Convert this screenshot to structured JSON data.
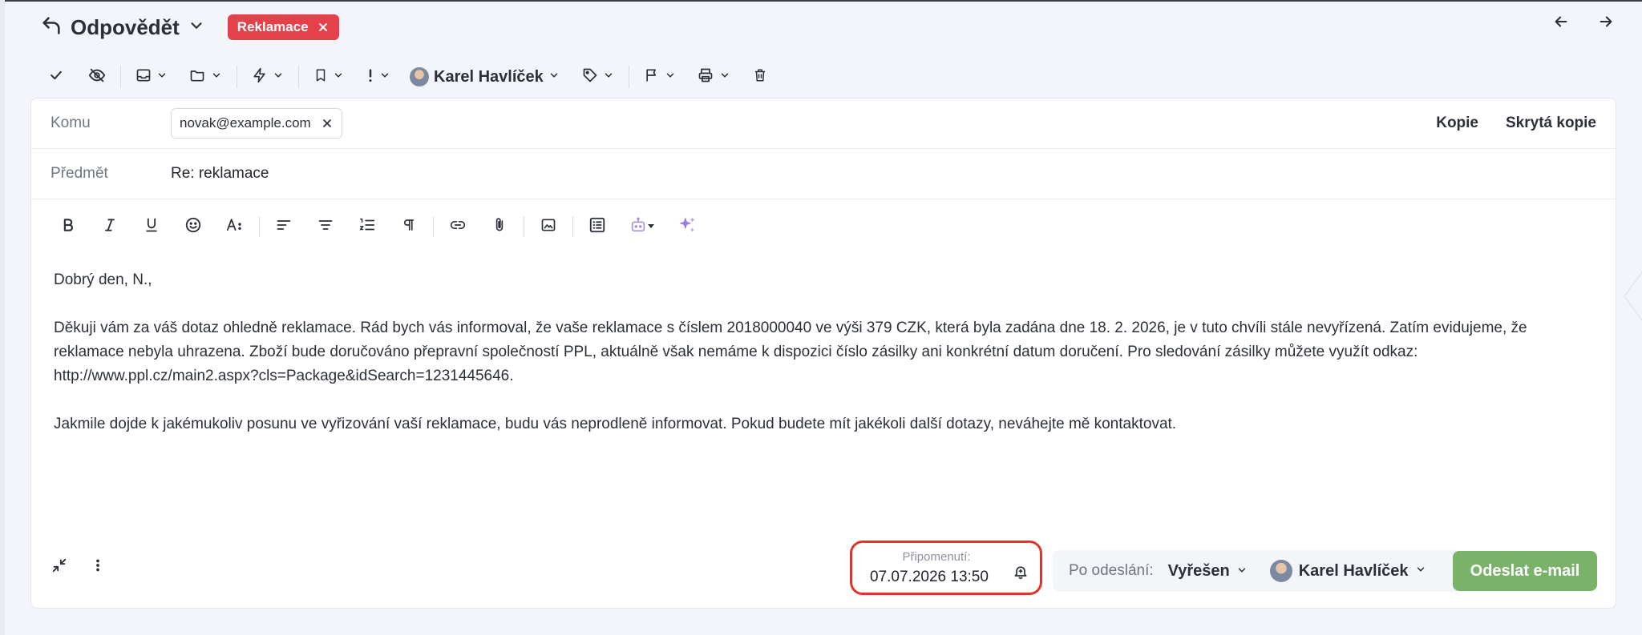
{
  "header": {
    "title": "Odpovědět",
    "tag": "Reklamace"
  },
  "toolbar": {
    "assignee": "Karel Havlíček"
  },
  "compose": {
    "to_label": "Komu",
    "to_recipient": "novak@example.com",
    "cc_label": "Kopie",
    "bcc_label": "Skrytá kopie",
    "subject_label": "Předmět",
    "subject_value": "Re: reklamace",
    "body": {
      "greeting": "Dobrý den, N.,",
      "paragraph1": "Děkuji vám za váš dotaz ohledně reklamace. Rád bych vás informoval, že vaše reklamace s číslem 2018000040 ve výši 379 CZK, která byla zadána dne 18. 2. 2026, je v tuto chvíli stále nevyřízená. Zatím evidujeme, že reklamace nebyla uhrazena. Zboží bude doručováno přepravní společností PPL, aktuálně však nemáme k dispozici číslo zásilky ani konkrétní datum doručení. Pro sledování zásilky můžete využít odkaz: http://www.ppl.cz/main2.aspx?cls=Package&idSearch=1231445646.",
      "paragraph2": "Jakmile dojde k jakémukoliv posunu ve vyřizování vaší reklamace, budu vás neprodleně informovat. Pokud budete mít jakékoli další dotazy, neváhejte mě kontaktovat."
    }
  },
  "footer": {
    "reminder_label": "Připomenutí:",
    "reminder_value": "07.07.2026 13:50",
    "after_send_label": "Po odeslání:",
    "after_send_status": "Vyřešen",
    "after_send_user": "Karel Havlíček",
    "send_label": "Odeslat e-mail"
  },
  "colors": {
    "tag": "#e5414a",
    "send": "#7ab26a",
    "highlight": "#e0342c"
  }
}
